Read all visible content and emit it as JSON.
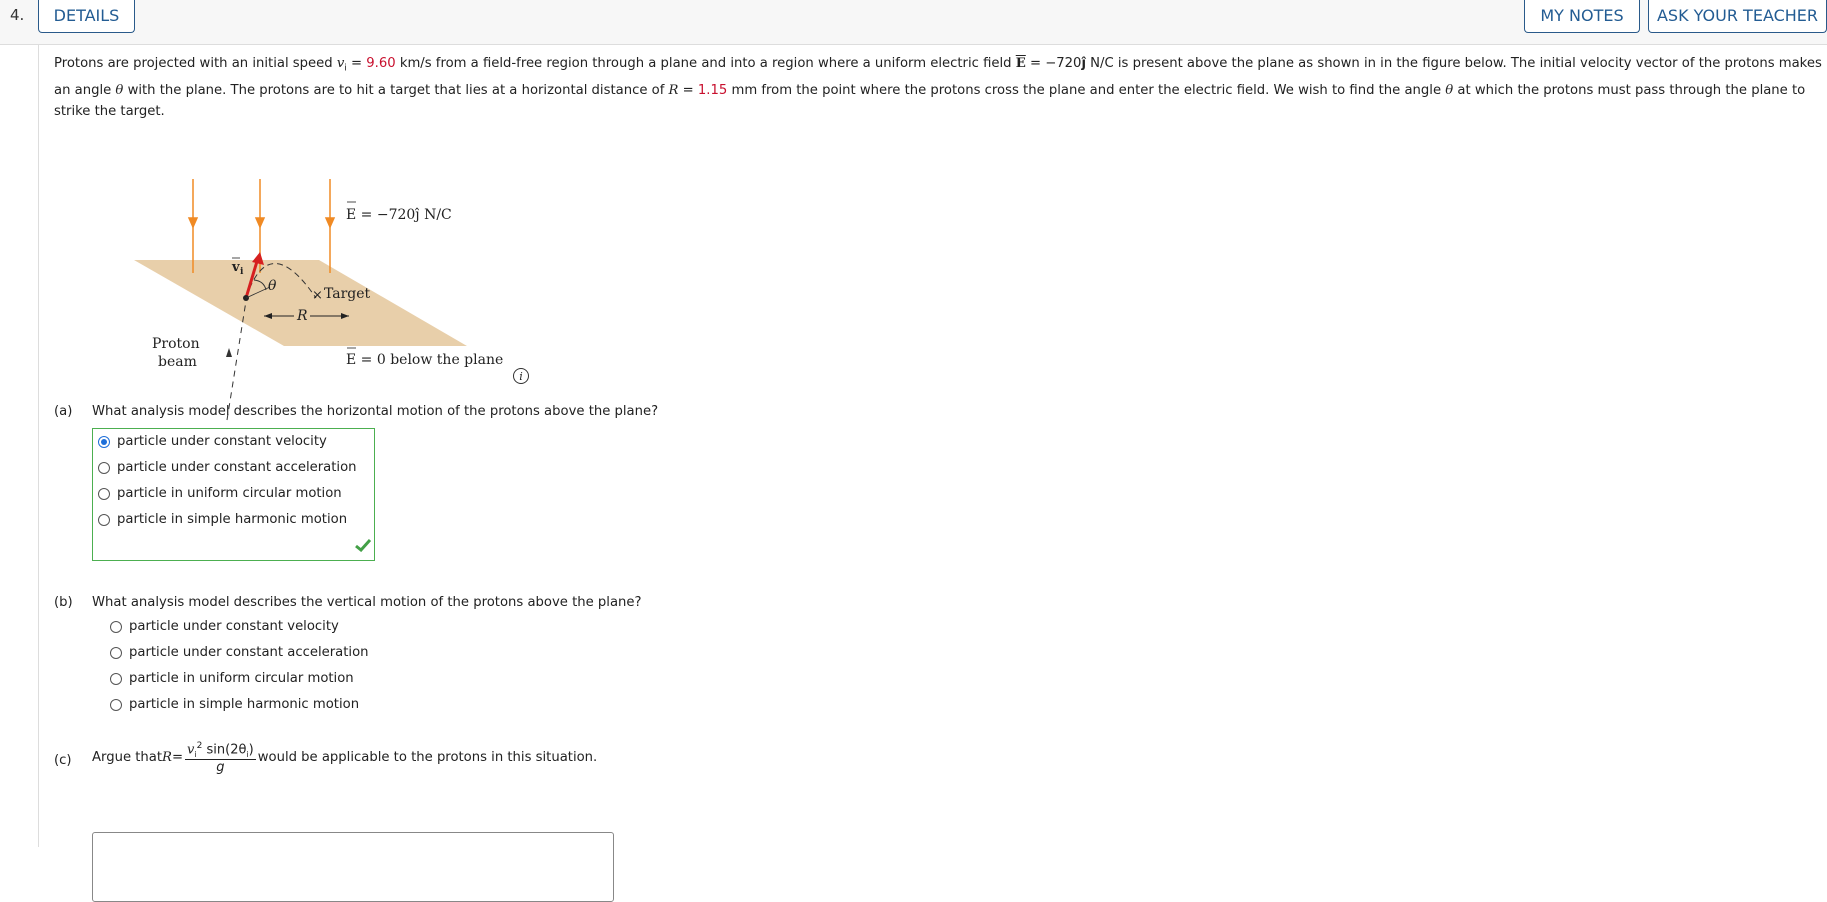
{
  "question_number": "4.",
  "buttons": {
    "details": "DETAILS",
    "my_notes": "MY NOTES",
    "ask_teacher": "ASK YOUR TEACHER"
  },
  "problem": {
    "t1": "Protons are projected with an initial speed ",
    "v_sym": "v",
    "v_sub": "i",
    "eq": " = ",
    "speed": "9.60",
    "t2": " km/s from a field-free region through a plane and into a region where a uniform electric field ",
    "E_sym": "E",
    "t3": " = −720",
    "j_hat": "ĵ",
    "t4": " N/C is present above the plane as shown in in the figure below. The initial velocity vector of the protons makes an angle ",
    "theta": "θ",
    "t5": " with the plane. The protons are to hit a target that lies at a horizontal distance of ",
    "R": "R",
    "eq2": " = ",
    "distance": "1.15",
    "t6": " mm from the point where the protons cross the plane and enter the electric field. We wish to find the angle ",
    "theta2": "θ",
    "t7": " at which the protons must pass through the plane to strike the target."
  },
  "figure": {
    "field_above": "E = −720ĵ N/C",
    "field_below": "E = 0 below the plane",
    "target": "Target",
    "proton": "Proton",
    "beam": "beam",
    "R": "R",
    "theta": "θ",
    "vi": "v",
    "vi_sub": "i",
    "colors": {
      "field_arrow": "#f08a24",
      "plane": "#e8cfaa",
      "velocity": "#d62020"
    }
  },
  "info_icon": "i",
  "part_a": {
    "label": "(a)",
    "question": "What analysis model describes the horizontal motion of the protons above the plane?",
    "options": [
      "particle under constant velocity",
      "particle under constant acceleration",
      "particle in uniform circular motion",
      "particle in simple harmonic motion"
    ],
    "selected_index": 0,
    "status": "correct"
  },
  "part_b": {
    "label": "(b)",
    "question": "What analysis model describes the vertical motion of the protons above the plane?",
    "options": [
      "particle under constant velocity",
      "particle under constant acceleration",
      "particle in uniform circular motion",
      "particle in simple harmonic motion"
    ]
  },
  "part_c": {
    "label": "(c)",
    "argue": "Argue that ",
    "R": "R",
    "eq": " = ",
    "num_v": "v",
    "num_sub": "i",
    "num_sup": "2",
    "num_sin": " sin(2θ",
    "num_sin_sub": "i",
    "num_close": ")",
    "den": "g",
    "tail": " would be applicable to the protons in this situation."
  }
}
